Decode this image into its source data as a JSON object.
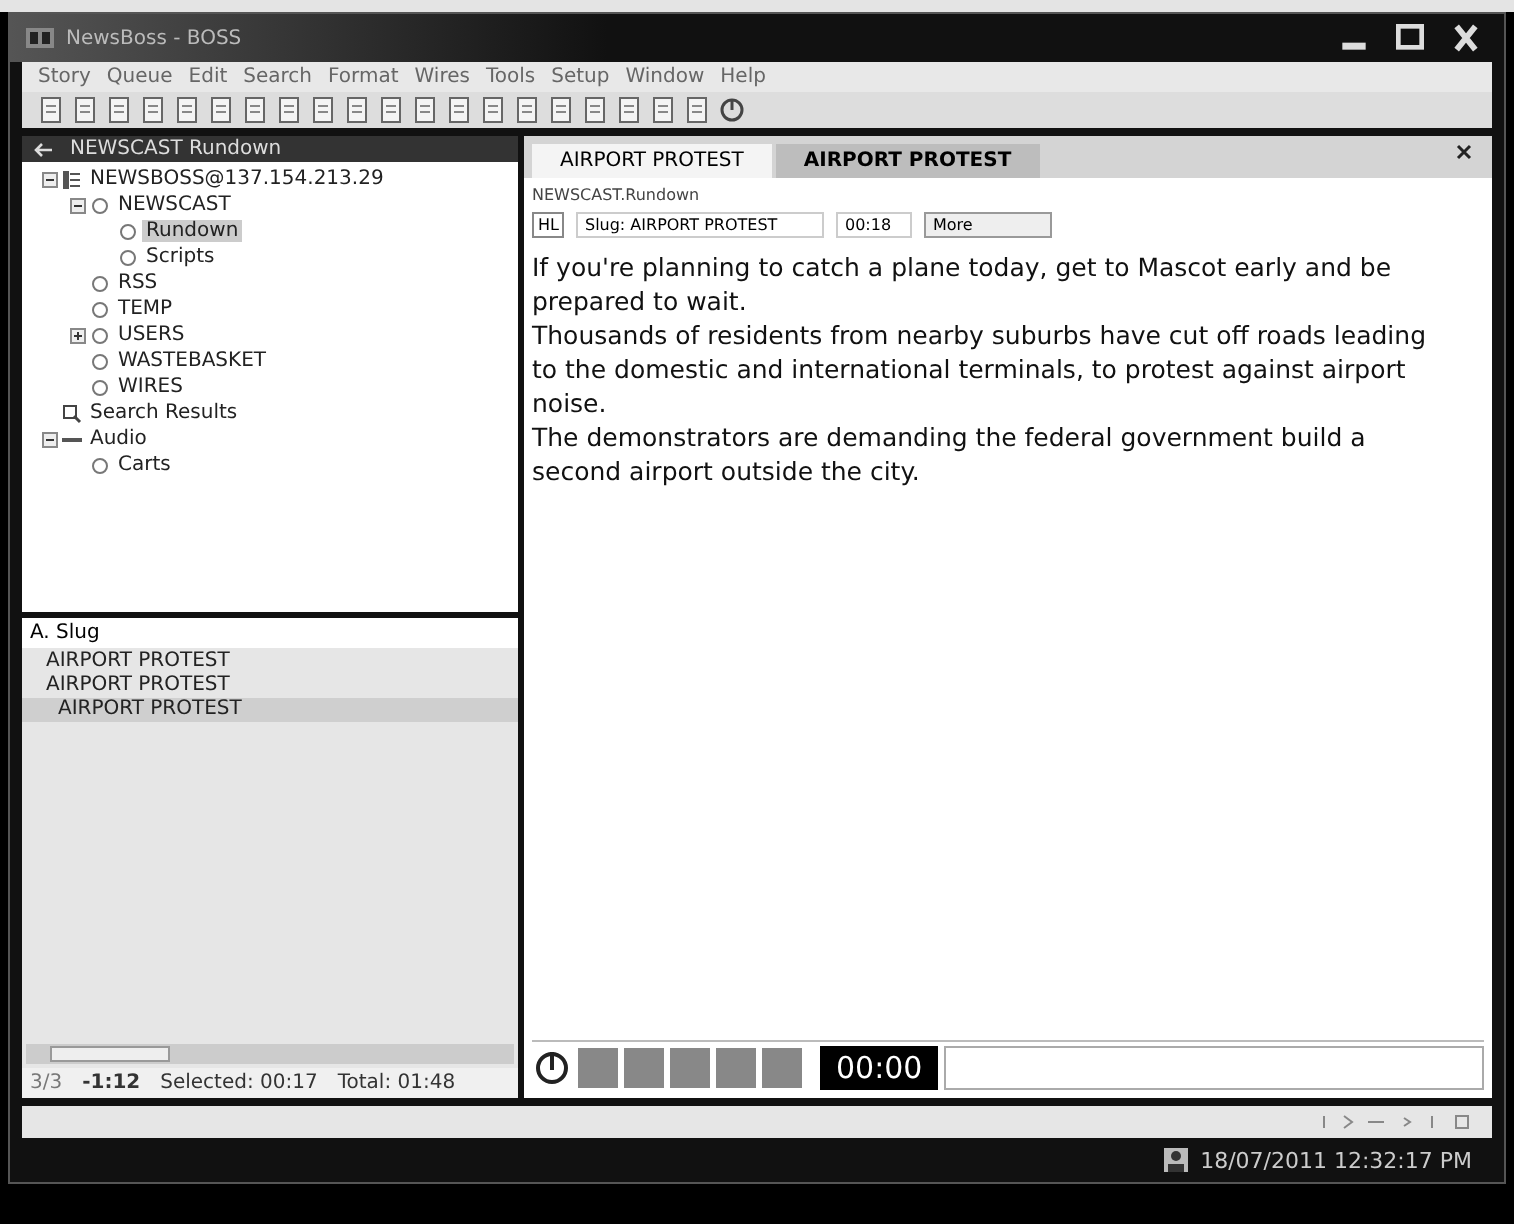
{
  "window": {
    "title": "NewsBoss - BOSS"
  },
  "menu": [
    "Story",
    "Queue",
    "Edit",
    "Search",
    "Format",
    "Wires",
    "Tools",
    "Setup",
    "Window",
    "Help"
  ],
  "tree_panel": {
    "title": "NEWSCAST Rundown",
    "items": [
      {
        "label": "NEWSBOSS@137.154.213.29",
        "kind": "server",
        "expanded": true,
        "selected": false,
        "children": [
          {
            "label": "NEWSCAST",
            "kind": "queue",
            "expanded": true,
            "selected": false,
            "children": [
              {
                "label": "Rundown",
                "kind": "queue",
                "selected": true
              },
              {
                "label": "Scripts",
                "kind": "queue",
                "selected": false
              }
            ]
          },
          {
            "label": "RSS",
            "kind": "queue",
            "selected": false
          },
          {
            "label": "TEMP",
            "kind": "queue",
            "selected": false
          },
          {
            "label": "USERS",
            "kind": "queue",
            "expanded": false,
            "selected": false
          },
          {
            "label": "WASTEBASKET",
            "kind": "queue",
            "selected": false
          },
          {
            "label": "WIRES",
            "kind": "queue",
            "selected": false
          }
        ]
      },
      {
        "label": "Search Results",
        "kind": "search",
        "selected": false
      },
      {
        "label": "Audio",
        "kind": "audio",
        "expanded": true,
        "selected": false,
        "children": [
          {
            "label": "Carts",
            "kind": "queue",
            "selected": false
          }
        ]
      }
    ]
  },
  "queue": {
    "column": "A. Slug",
    "rows": [
      {
        "slug": "AIRPORT PROTEST",
        "selected": false
      },
      {
        "slug": "AIRPORT PROTEST",
        "selected": false
      },
      {
        "slug": "AIRPORT PROTEST",
        "selected": true
      }
    ],
    "position": "3/3",
    "remaining": "-1:12",
    "selected_time": "Selected: 00:17",
    "total": "Total: 01:48"
  },
  "editor": {
    "tabs": [
      {
        "label": "AIRPORT PROTEST",
        "selected": false
      },
      {
        "label": "AIRPORT PROTEST",
        "selected": true
      }
    ],
    "path": "NEWSCAST.Rundown",
    "hl": "HL",
    "slug": "Slug: AIRPORT PROTEST",
    "duration": "00:18",
    "more": "More",
    "body": [
      "If you're planning to catch a plane today, get to Mascot early and be prepared to wait.",
      "Thousands of residents from nearby suburbs have cut off roads leading to the domestic and international terminals, to protest against airport noise.",
      "The demonstrators are demanding the federal government build a second airport outside the city."
    ],
    "timer": "00:00"
  },
  "status_bar": {
    "datetime": "18/07/2011 12:32:17 PM"
  }
}
